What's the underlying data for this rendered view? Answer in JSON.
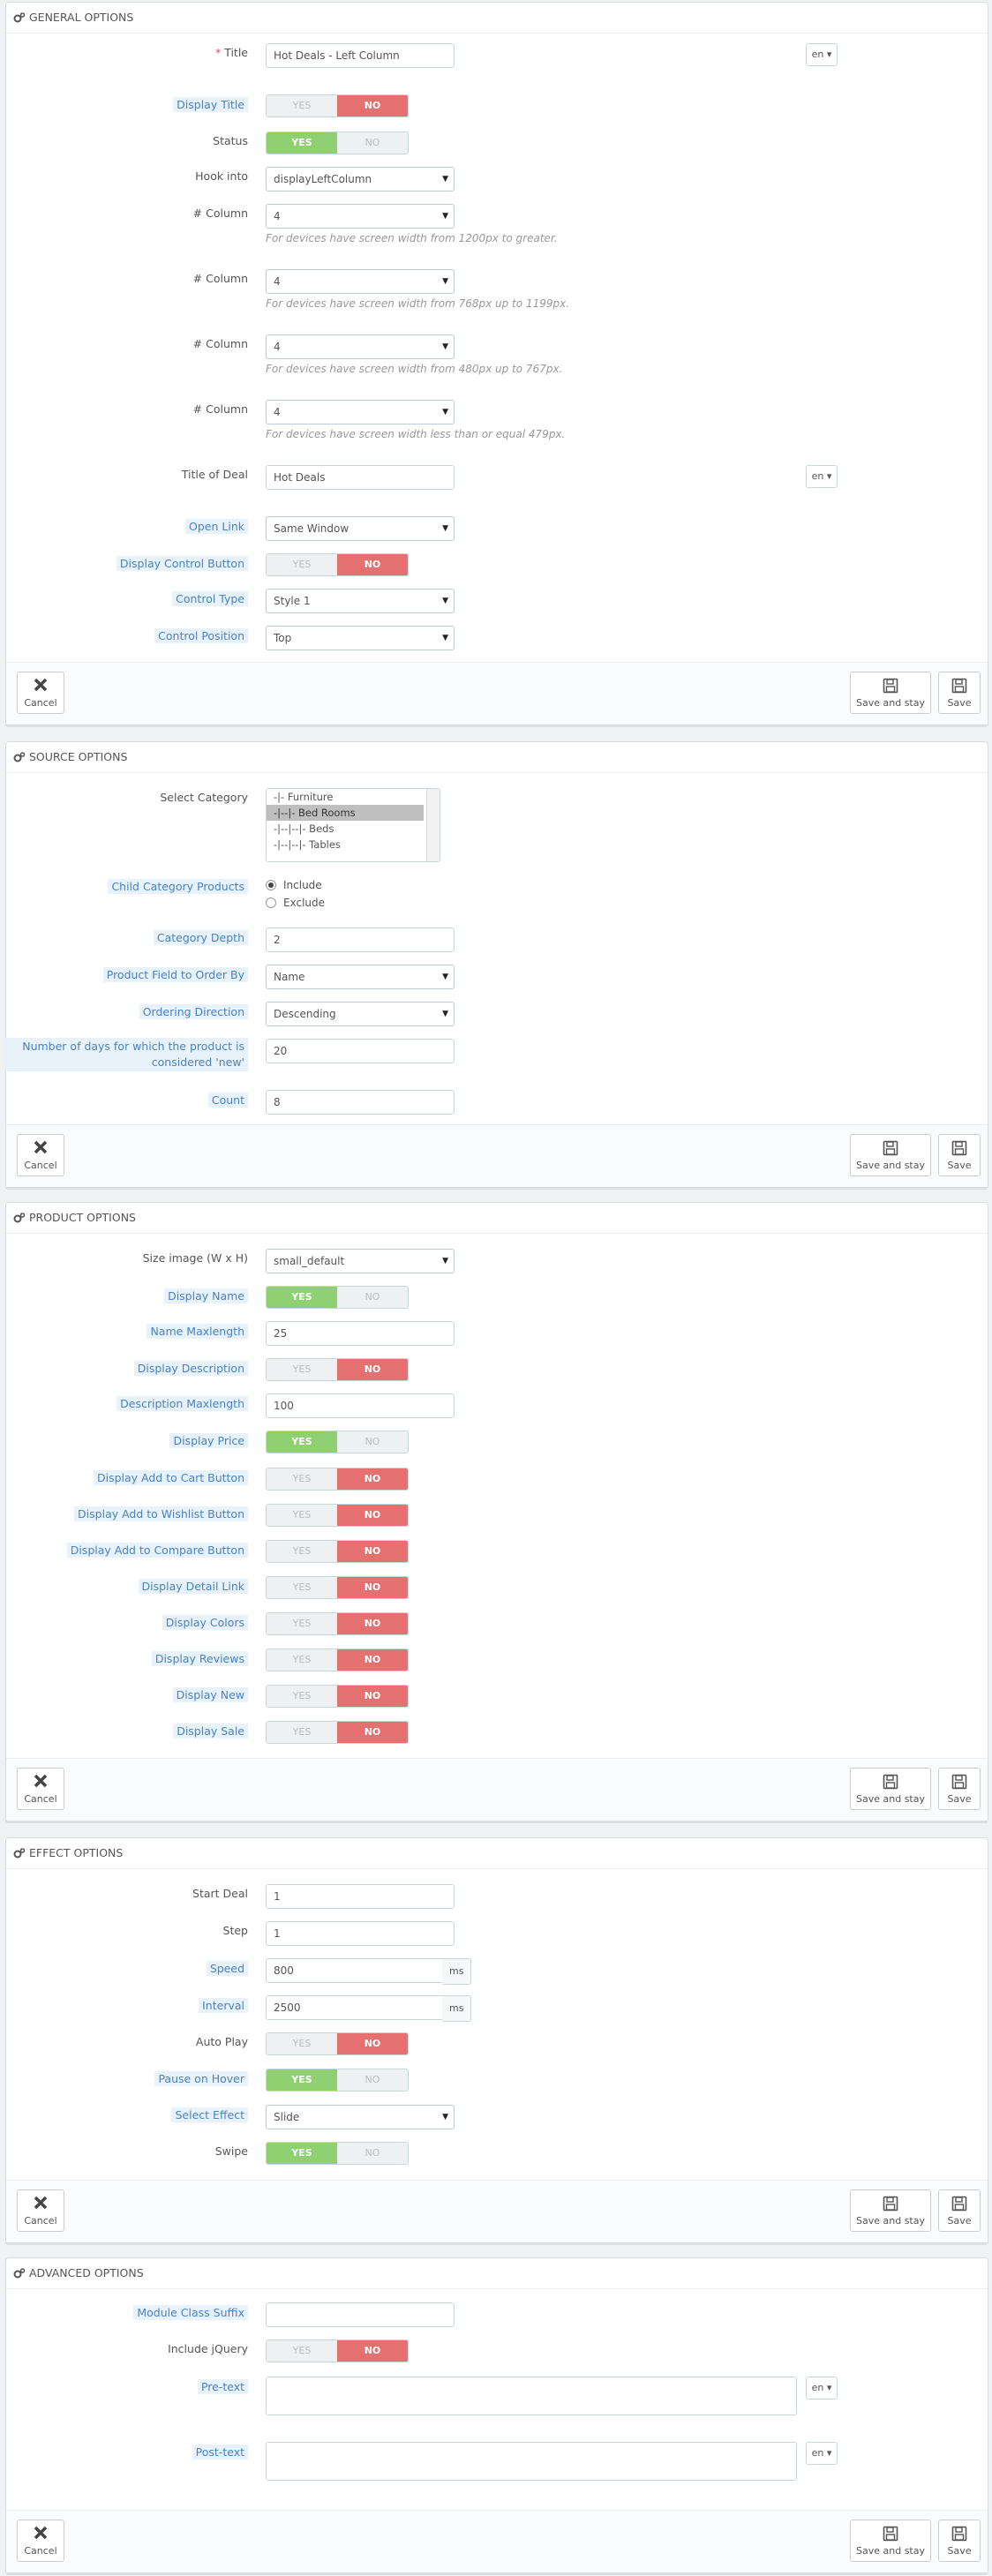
{
  "general": {
    "header": "General Options",
    "title_label": "Title",
    "title_value": "Hot Deals - Left Column",
    "lang": "en",
    "display_title_label": "Display Title",
    "status_label": "Status",
    "hook_label": "Hook into",
    "hook_value": "displayLeftColumn",
    "column_label": "# Column",
    "column_value": "4",
    "help_1200": "For devices have screen width from 1200px to greater.",
    "help_768": "For devices have screen width from 768px up to 1199px.",
    "help_480": "For devices have screen width from 480px up to 767px.",
    "help_479": "For devices have screen width less than or equal 479px.",
    "deal_title_label": "Title of Deal",
    "deal_title_value": "Hot Deals",
    "open_link_label": "Open Link",
    "open_link_value": "Same Window",
    "display_control_label": "Display Control Button",
    "control_type_label": "Control Type",
    "control_type_value": "Style 1",
    "control_position_label": "Control Position",
    "control_position_value": "Top"
  },
  "common": {
    "yes": "YES",
    "no": "NO",
    "cancel": "Cancel",
    "save_stay": "Save and stay",
    "save": "Save"
  },
  "source": {
    "header": "Source Options",
    "category_label": "Select Category",
    "categories": [
      "-|- Furniture",
      "-|--|- Bed Rooms",
      "-|--|--|- Beds",
      "-|--|--|- Tables"
    ],
    "child_label": "Child Category Products",
    "include": "Include",
    "exclude": "Exclude",
    "depth_label": "Category Depth",
    "depth_value": "2",
    "order_by_label": "Product Field to Order By",
    "order_by_value": "Name",
    "direction_label": "Ordering Direction",
    "direction_value": "Descending",
    "days_label": "Number of days for which the product is considered 'new'",
    "days_value": "20",
    "count_label": "Count",
    "count_value": "8"
  },
  "product": {
    "header": "Product Options",
    "size_label": "Size image (W x H)",
    "size_value": "small_default",
    "display_name_label": "Display Name",
    "name_max_label": "Name Maxlength",
    "name_max_value": "25",
    "display_desc_label": "Display Description",
    "desc_max_label": "Description Maxlength",
    "desc_max_value": "100",
    "display_price_label": "Display Price",
    "add_cart_label": "Display Add to Cart Button",
    "add_wishlist_label": "Display Add to Wishlist Button",
    "add_compare_label": "Display Add to Compare Button",
    "detail_link_label": "Display Detail Link",
    "colors_label": "Display Colors",
    "reviews_label": "Display Reviews",
    "new_label": "Display New",
    "sale_label": "Display Sale"
  },
  "effect": {
    "header": "Effect Options",
    "start_label": "Start Deal",
    "start_value": "1",
    "step_label": "Step",
    "step_value": "1",
    "speed_label": "Speed",
    "speed_value": "800",
    "interval_label": "Interval",
    "interval_value": "2500",
    "unit": "ms",
    "autoplay_label": "Auto Play",
    "pause_label": "Pause on Hover",
    "effect_label": "Select Effect",
    "effect_value": "Slide",
    "swipe_label": "Swipe"
  },
  "advanced": {
    "header": "Advanced Options",
    "suffix_label": "Module Class Suffix",
    "jquery_label": "Include jQuery",
    "pretext_label": "Pre-text",
    "posttext_label": "Post-text"
  }
}
